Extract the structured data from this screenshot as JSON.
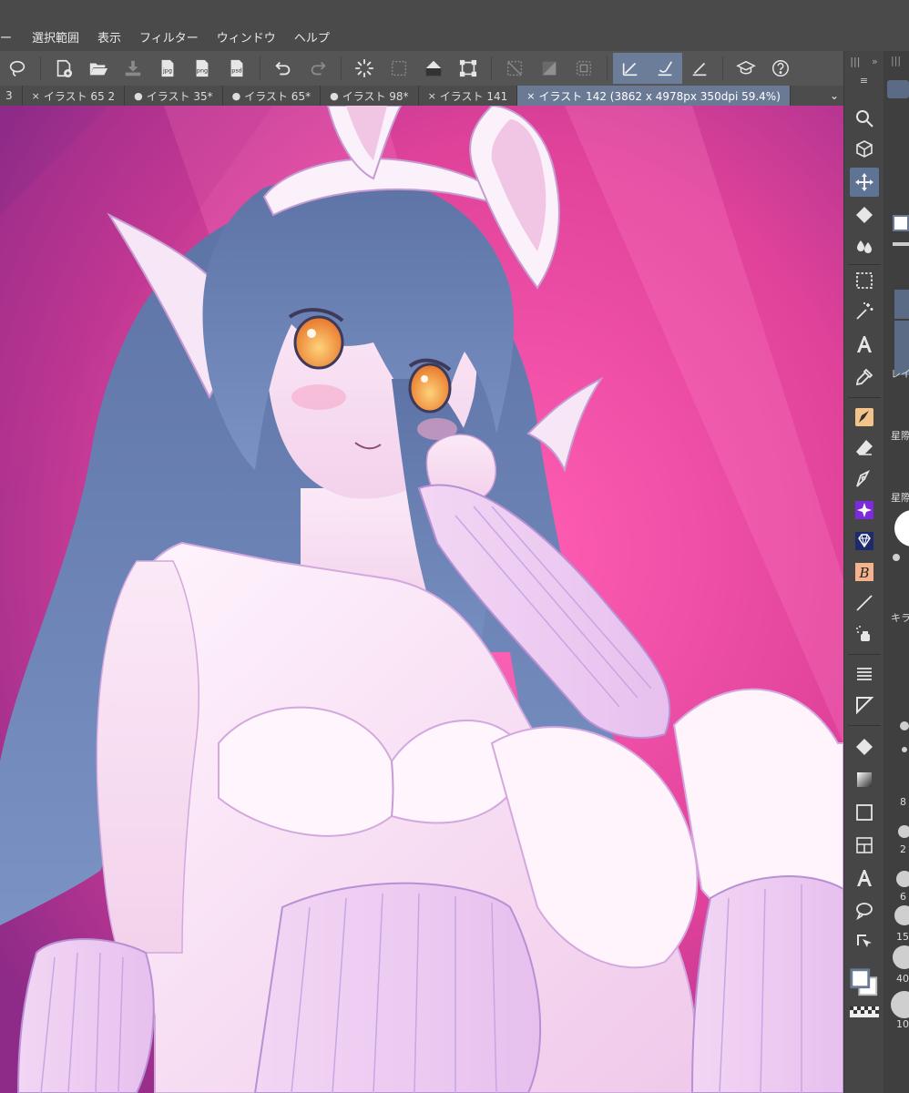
{
  "menu": {
    "items": [
      "ー",
      "選択範囲",
      "表示",
      "フィルター",
      "ウィンドウ",
      "ヘルプ"
    ]
  },
  "toolbar": {
    "buttons": [
      {
        "icon": "lasso-icon"
      },
      {
        "icon": "new-file-icon"
      },
      {
        "icon": "open-folder-icon"
      },
      {
        "icon": "save-icon"
      },
      {
        "icon": "export-jpg-icon",
        "label": "jpg"
      },
      {
        "icon": "export-png-icon",
        "label": "png"
      },
      {
        "icon": "export-psd-icon",
        "label": "psd"
      },
      {
        "icon": "undo-icon"
      },
      {
        "icon": "redo-icon"
      },
      {
        "icon": "loading-icon"
      },
      {
        "icon": "select-clear-icon"
      },
      {
        "icon": "fill-icon"
      },
      {
        "icon": "transform-icon"
      },
      {
        "icon": "invert-selection-icon"
      },
      {
        "icon": "selection-gradient-icon"
      },
      {
        "icon": "selection-border-icon"
      },
      {
        "icon": "ruler-snap-icon"
      },
      {
        "icon": "brush-snap-icon"
      },
      {
        "icon": "ruler-edit-icon"
      },
      {
        "icon": "learn-icon"
      },
      {
        "icon": "help-icon"
      }
    ]
  },
  "tabs": [
    {
      "mark": "",
      "label": "3"
    },
    {
      "mark": "×",
      "label": "イラスト 65 2"
    },
    {
      "mark": "●",
      "label": "イラスト 35*"
    },
    {
      "mark": "●",
      "label": "イラスト 65*"
    },
    {
      "mark": "●",
      "label": "イラスト 98*"
    },
    {
      "mark": "×",
      "label": "イラスト 141"
    },
    {
      "mark": "×",
      "label": "イラスト 142 (3862 x 4978px 350dpi 59.4%)"
    }
  ],
  "tab_more": "⌄",
  "toolcol": {
    "head_left": "|||",
    "head_right": "»",
    "menu": "≡"
  },
  "sidepanel": {
    "head": "|||",
    "labels": [
      "レイ",
      "星際",
      "星際",
      "キラ"
    ],
    "numbers": [
      "8",
      "2",
      "6",
      "15",
      "40",
      "10"
    ]
  },
  "colors": {
    "bg_pink": "#e0429a",
    "bg_purple": "#8e2a88",
    "hair": "#6f86b8",
    "accent": "#6a7a95"
  }
}
